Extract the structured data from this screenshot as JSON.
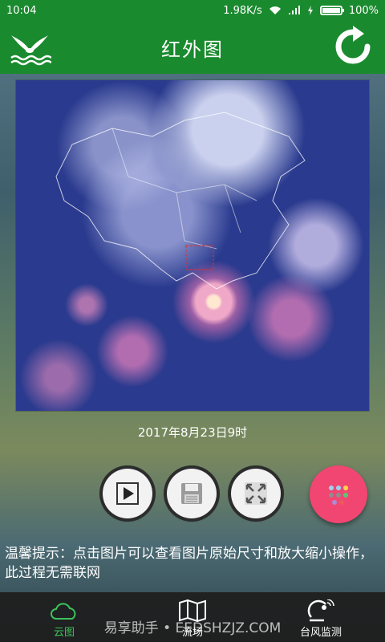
{
  "status": {
    "time": "10:04",
    "speed": "1.98K/s",
    "battery": "100%",
    "battery_fraction": 1.0
  },
  "header": {
    "title": "红外图"
  },
  "image": {
    "timestamp": "2017年8月23日9时"
  },
  "controls": [
    {
      "name": "play-button",
      "icon": "play-icon"
    },
    {
      "name": "save-button",
      "icon": "floppy-icon"
    },
    {
      "name": "fullscreen-button",
      "icon": "fullscreen-icon"
    }
  ],
  "tip": {
    "text": "温馨提示：点击图片可以查看图片原始尺寸和放大缩小操作，此过程无需联网"
  },
  "tabs": [
    {
      "label": "云图",
      "icon": "cloud-icon",
      "active": true
    },
    {
      "label": "流场",
      "icon": "map-icon",
      "active": false
    },
    {
      "label": "台风监测",
      "icon": "radar-icon",
      "active": false
    }
  ],
  "watermark": "易享助手 • EEDSHZJZ.COM",
  "colors": {
    "primary": "#1a8a2e",
    "accent": "#f14672",
    "tab_active": "#3cc35a"
  }
}
